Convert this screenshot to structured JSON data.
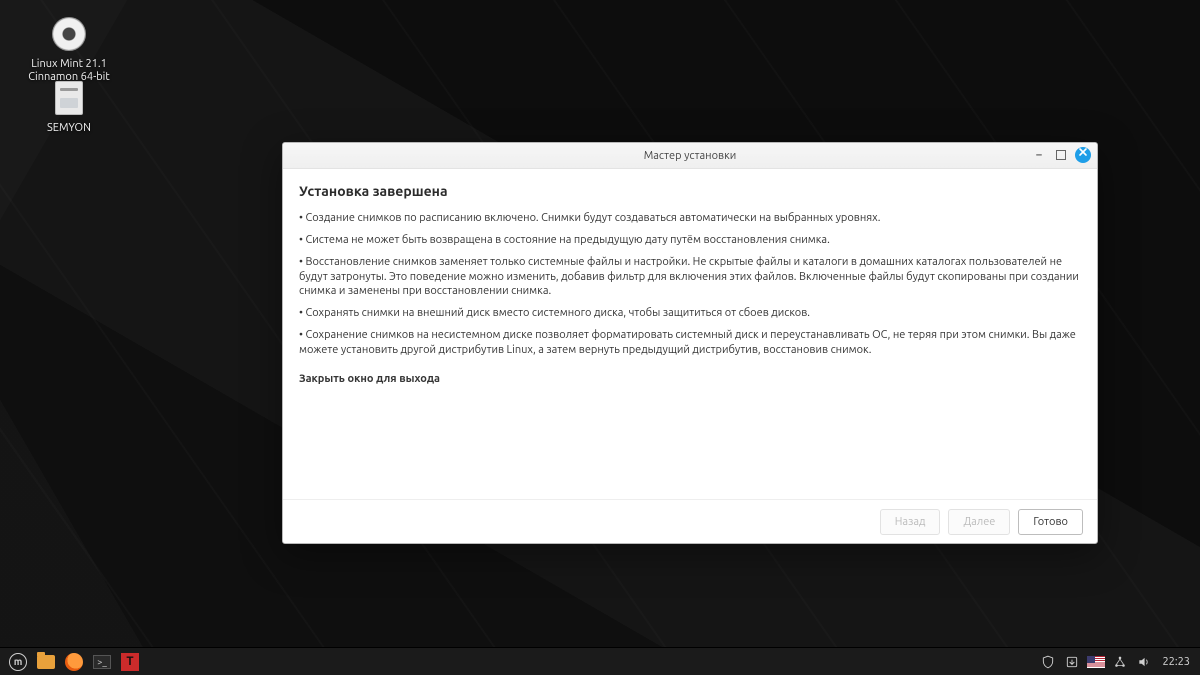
{
  "desktop": {
    "icons": [
      {
        "label_line1": "Linux Mint 21.1",
        "label_line2": "Cinnamon 64-bit"
      },
      {
        "label_line1": "SEMYON",
        "label_line2": ""
      }
    ]
  },
  "window": {
    "title": "Мастер установки",
    "heading": "Установка завершена",
    "bullets": [
      "• Создание снимков по расписанию включено. Снимки будут создаваться автоматически на выбранных уровнях.",
      "• Система не может быть возвращена в состояние на предыдущую дату путём восстановления снимка.",
      "• Восстановление снимков заменяет только системные файлы и настройки. Не скрытые файлы и каталоги в домашних каталогах пользователей не будут затронуты. Это поведение можно изменить, добавив фильтр для включения этих файлов. Включенные файлы будут скопированы при создании снимка и заменены при восстановлении снимка.",
      "• Сохранять снимки на внешний диск вместо системного диска, чтобы защититься от сбоев дисков.",
      "• Сохранение снимков на несистемном диске позволяет форматировать системный диск и переустанавливать ОС, не теряя при этом снимки. Вы даже можете установить другой дистрибутив Linux, а затем вернуть предыдущий дистрибутив, восстановив снимок."
    ],
    "closing": "Закрыть окно для выхода",
    "buttons": {
      "back": "Назад",
      "next": "Далее",
      "finish": "Готово"
    }
  },
  "panel": {
    "clock": "22:23",
    "mint_glyph": "m",
    "term_glyph": ">_",
    "ts_glyph": "T"
  }
}
